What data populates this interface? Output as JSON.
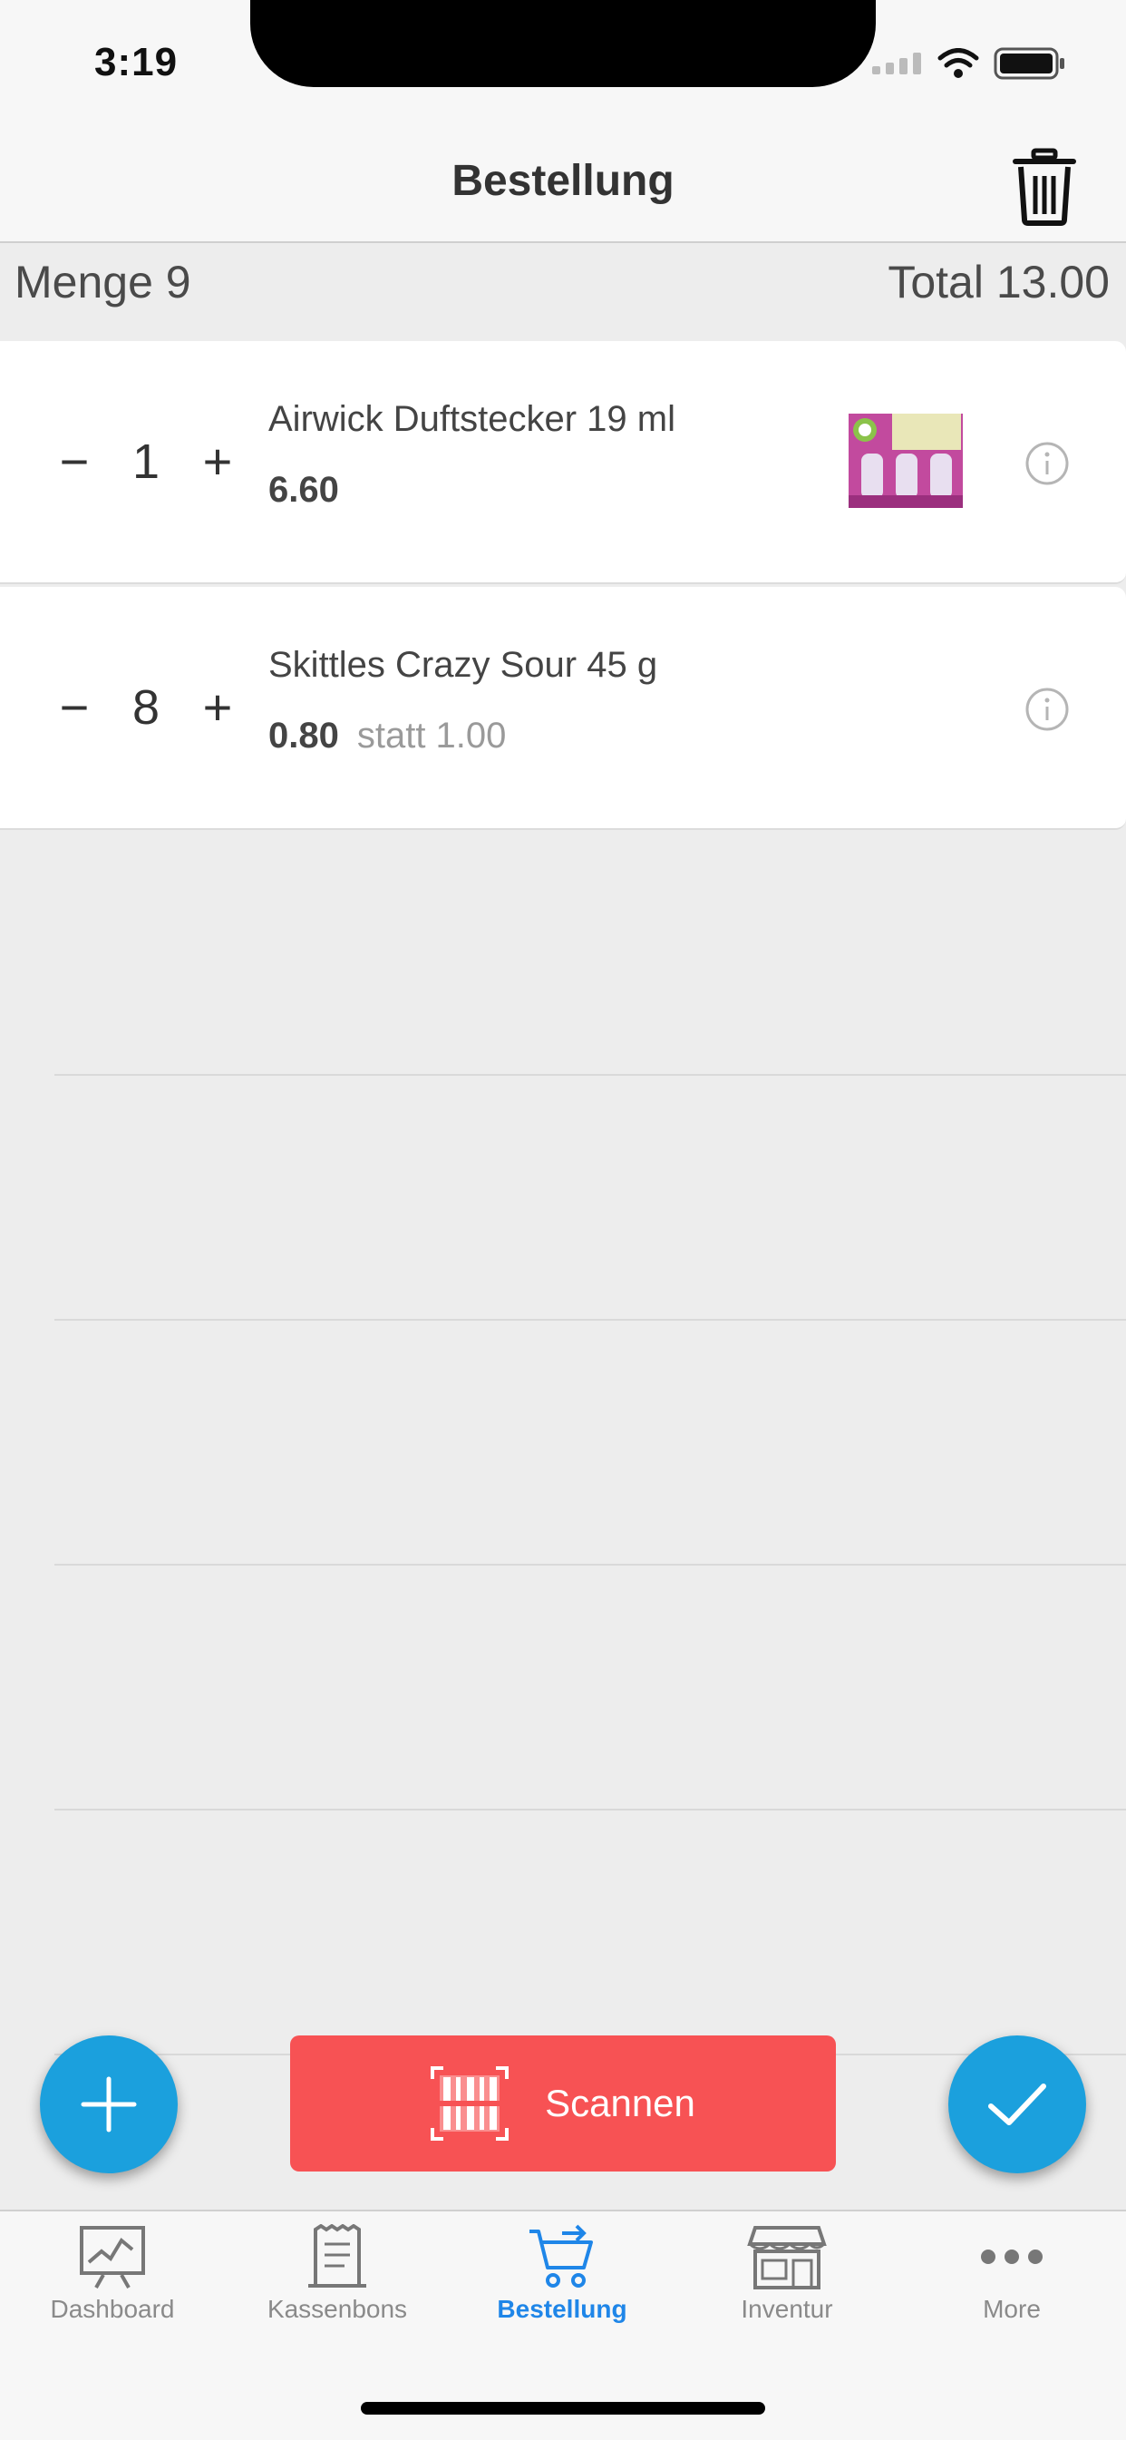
{
  "status_bar": {
    "time": "3:19"
  },
  "nav": {
    "title": "Bestellung"
  },
  "summary": {
    "quantity": "Menge 9",
    "total": "Total 13.00"
  },
  "items": [
    {
      "name": "Airwick Duftstecker 19 ml",
      "qty": "1",
      "price": "6.60",
      "old_price": "",
      "has_image": true
    },
    {
      "name": "Skittles Crazy Sour 45 g",
      "qty": "8",
      "price": "0.80",
      "old_price": "statt 1.00",
      "has_image": false
    }
  ],
  "stepper": {
    "minus": "−",
    "plus": "+"
  },
  "scan_button": {
    "label": "Scannen"
  },
  "tabs": [
    {
      "label": "Dashboard",
      "icon": "chart-board-icon",
      "active": false
    },
    {
      "label": "Kassenbons",
      "icon": "receipt-icon",
      "active": false
    },
    {
      "label": "Bestellung",
      "icon": "cart-icon",
      "active": true
    },
    {
      "label": "Inventur",
      "icon": "store-icon",
      "active": false
    },
    {
      "label": "More",
      "icon": "more-dots-icon",
      "active": false
    }
  ],
  "colors": {
    "accent": "#1ba0dd",
    "scan": "#f75254",
    "active_tab": "#1f86e8",
    "background": "#ededed"
  }
}
